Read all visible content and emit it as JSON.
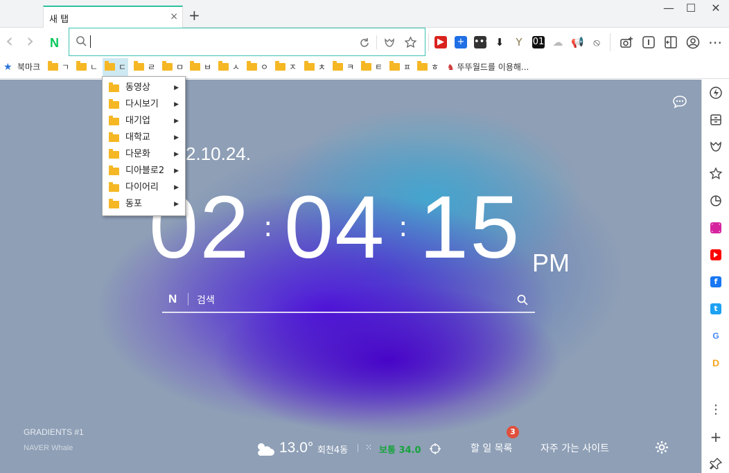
{
  "tab": {
    "title": "새 탭",
    "close": "×",
    "new": "+"
  },
  "window": {
    "minimize": "—",
    "maximize": "☐",
    "close": "✕"
  },
  "toolbar": {
    "back": "‹",
    "forward": "›",
    "naver_logo": "N",
    "omnibox_value": "",
    "ext_labels": [
      "▶",
      "+",
      "•••",
      "⬇",
      "Y",
      "01",
      "☁",
      "📢",
      "⦸"
    ],
    "ext_colors": [
      "#d9231e",
      "#1f6fe5",
      "#333333",
      "#222222",
      "#8a7a52",
      "#111111",
      "#bbbbbb",
      "#e8941a",
      "#444444"
    ],
    "menu": "⋯"
  },
  "bookmarks": {
    "star": "★",
    "items": [
      "북마크",
      "ㄱ",
      "ㄴ",
      "ㄷ",
      "ㄹ",
      "ㅁ",
      "ㅂ",
      "ㅅ",
      "ㅇ",
      "ㅈ",
      "ㅊ",
      "ㅋ",
      "ㅌ",
      "ㅍ",
      "ㅎ"
    ],
    "last": "뚜뚜월드를 이용해..."
  },
  "dropdown": {
    "items": [
      "동영상",
      "다시보기",
      "대기업",
      "대학교",
      "다문화",
      "디아블로2",
      "다이어리",
      "동포"
    ],
    "arrow": "▶"
  },
  "newtab_page": {
    "date": "2.10.24.",
    "hours": "02",
    "minutes": "04",
    "seconds": "15",
    "colon": ":",
    "ampm": "PM",
    "search_logo": "N",
    "search_placeholder": "검색",
    "credit_title": "GRADIENTS #1",
    "credit_sub": "NAVER Whale",
    "temperature": "13.0°",
    "location": "회천4동",
    "dust_icon": "⁙",
    "dust": "보통 34.0",
    "todo": "할 일 목록",
    "todo_count": "3",
    "frequent": "자주 가는 사이트"
  },
  "sidebar": {
    "labels": [
      "f",
      "t",
      "G",
      "D"
    ],
    "colors": {
      "instagram": "#d6249f",
      "youtube": "#ff0000",
      "facebook": "#1877f2",
      "twitter": "#1da1f2"
    },
    "more": "⋮",
    "add": "+"
  }
}
